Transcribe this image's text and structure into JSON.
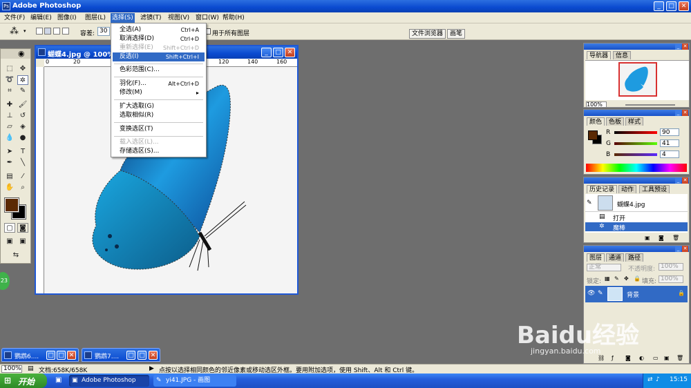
{
  "app": {
    "title": "Adobe Photoshop",
    "menus": [
      "文件(F)",
      "编辑(E)",
      "图像(I)",
      "图层(L)",
      "选择(S)",
      "滤镜(T)",
      "视图(V)",
      "窗口(W)",
      "帮助(H)"
    ]
  },
  "options": {
    "tolerance_label": "容差:",
    "tolerance_value": "30",
    "all_layers_label": "用于所有图层",
    "file_browser": "文件浏览器",
    "brushes": "画笔"
  },
  "select_menu": {
    "items": [
      {
        "label": "全选(A)",
        "shortcut": "Ctrl+A",
        "state": "normal"
      },
      {
        "label": "取消选择(D)",
        "shortcut": "Ctrl+D",
        "state": "normal"
      },
      {
        "label": "重新选择(E)",
        "shortcut": "Shift+Ctrl+D",
        "state": "disabled"
      },
      {
        "label": "反选(I)",
        "shortcut": "Shift+Ctrl+I",
        "state": "highlighted"
      },
      {
        "label": "色彩范围(C)...",
        "shortcut": "",
        "state": "normal"
      },
      {
        "label": "羽化(F)...",
        "shortcut": "Alt+Ctrl+D",
        "state": "normal"
      },
      {
        "label": "修改(M)",
        "shortcut": "▸",
        "state": "normal"
      },
      {
        "label": "扩大选取(G)",
        "shortcut": "",
        "state": "normal"
      },
      {
        "label": "选取相似(R)",
        "shortcut": "",
        "state": "normal"
      },
      {
        "label": "变换选区(T)",
        "shortcut": "",
        "state": "normal"
      },
      {
        "label": "载入选区(L)...",
        "shortcut": "",
        "state": "disabled"
      },
      {
        "label": "存储选区(S)...",
        "shortcut": "",
        "state": "normal"
      }
    ]
  },
  "document": {
    "title": "蝴蝶4.jpg @ 100%",
    "ruler_ticks": [
      "0",
      "20",
      "120",
      "140",
      "160"
    ]
  },
  "navigator": {
    "tabs": [
      "导航器",
      "信息"
    ],
    "zoom": "100%"
  },
  "color": {
    "tabs": [
      "颜色",
      "色板",
      "样式"
    ],
    "r_label": "R",
    "r_value": "90",
    "g_label": "G",
    "g_value": "41",
    "b_label": "B",
    "b_value": "4",
    "foreground": "#5a2904",
    "background": "#000000"
  },
  "history": {
    "tabs": [
      "历史记录",
      "动作",
      "工具预设"
    ],
    "snapshot": "蝴蝶4.jpg",
    "steps": [
      "打开",
      "魔棒"
    ]
  },
  "layers": {
    "tabs": [
      "图层",
      "通道",
      "路径"
    ],
    "blend_mode": "正常",
    "opacity_label": "不透明度:",
    "opacity_value": "100%",
    "lock_label": "锁定:",
    "fill_label": "填充:",
    "fill_value": "100%",
    "layer_name": "背景"
  },
  "minimized": [
    "鹦鹉6....",
    "鹦鹉7...."
  ],
  "status": {
    "zoom": "100%",
    "doc_size": "文档:658K/658K",
    "hint": "点按以选择相同颜色的邻近像素或移动选区外框。要用附加选项，使用 Shift、Alt 和 Ctrl 键。"
  },
  "taskbar": {
    "start": "开始",
    "buttons": [
      "Adobe Photoshop",
      "yi41.JPG - 画图"
    ],
    "clock": "15:15"
  },
  "watermark": {
    "brand": "Baidu经验",
    "url": "jingyan.baidu.com"
  },
  "side_badge": "23"
}
